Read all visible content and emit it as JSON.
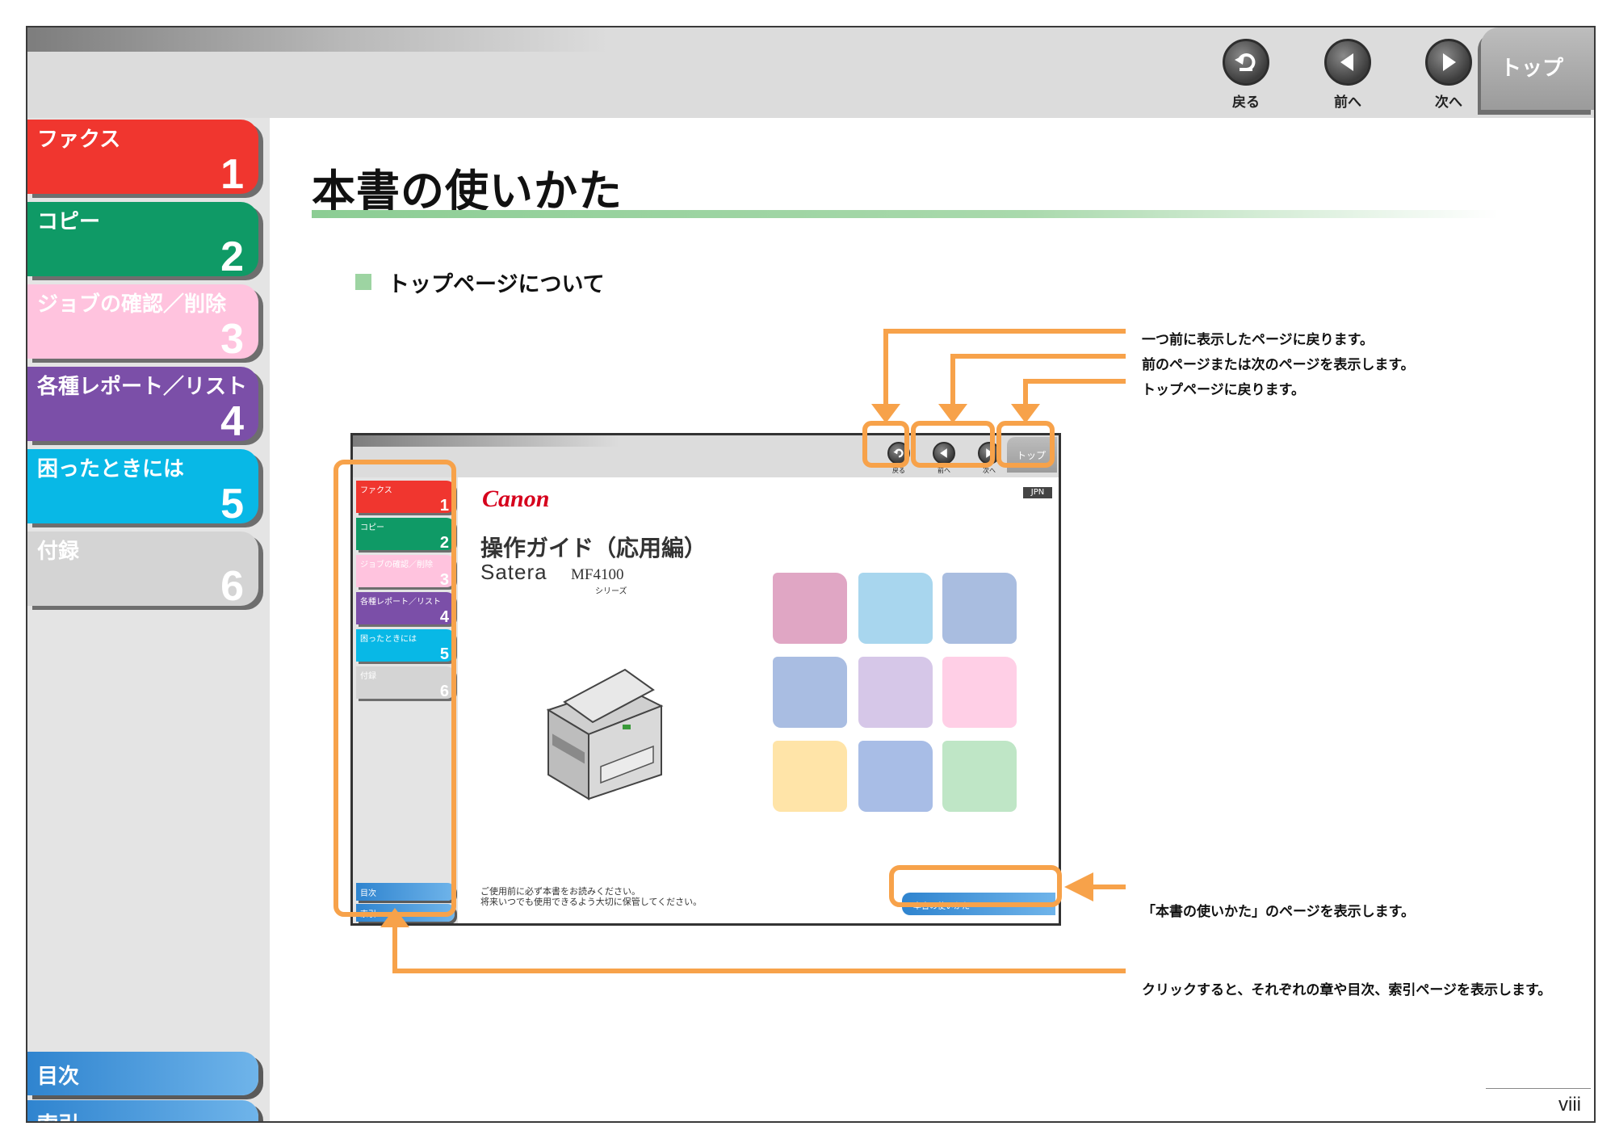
{
  "header": {
    "nav": [
      {
        "label": "戻る",
        "icon": "back-arrow-icon"
      },
      {
        "label": "前へ",
        "icon": "triangle-left-icon"
      },
      {
        "label": "次へ",
        "icon": "triangle-right-icon"
      }
    ],
    "top_tab": "トップ"
  },
  "sidebar": {
    "chapters": [
      {
        "label": "ファクス",
        "num": "1",
        "color": "#f0362f"
      },
      {
        "label": "コピー",
        "num": "2",
        "color": "#0f9a66"
      },
      {
        "label": "ジョブの確認／削除",
        "num": "3",
        "color": "#ffc3de"
      },
      {
        "label": "各種レポート／リスト",
        "num": "4",
        "color": "#7b4fa8"
      },
      {
        "label": "困ったときには",
        "num": "5",
        "color": "#08b8e6"
      },
      {
        "label": "付録",
        "num": "6",
        "color": "#d4d4d4"
      }
    ],
    "contents": "目次",
    "index": "索引"
  },
  "main": {
    "title": "本書の使いかた",
    "section": "トップページについて",
    "callouts": {
      "back": "一つ前に表示したページに戻ります。",
      "prevnext": "前のページまたは次のページを表示します。",
      "top": "トップページに戻ります。",
      "howto": "「本書の使いかた」のページを表示します。",
      "chapters": "クリックすると、それぞれの章や目次、索引ページを表示します。"
    },
    "page_number": "viii"
  },
  "mini": {
    "nav": [
      "戻る",
      "前へ",
      "次へ"
    ],
    "top_tab": "トップ",
    "logo": "Canon",
    "lang": "JPN",
    "guide_title": "操作ガイド（応用編）",
    "brand": "Satera",
    "model": "MF4100",
    "series": "シリーズ",
    "chapters": [
      {
        "label": "ファクス",
        "num": "1"
      },
      {
        "label": "コピー",
        "num": "2"
      },
      {
        "label": "ジョブの確認／削除",
        "num": "3"
      },
      {
        "label": "各種レポート／リスト",
        "num": "4"
      },
      {
        "label": "困ったときには",
        "num": "5"
      },
      {
        "label": "付録",
        "num": "6"
      }
    ],
    "contents": "目次",
    "index": "索引",
    "notice_line1": "ご使用前に必ず本書をお読みください。",
    "notice_line2": "将来いつでも使用できるよう大切に保管してください。",
    "howto_button": "本書の使いかた",
    "tile_colors": [
      "#e0a6c4",
      "#a8d6ee",
      "#a9bde0",
      "#a9bde2",
      "#d6c7e8",
      "#ffcfe6",
      "#ffe4a8",
      "#a8bde6",
      "#bfe6c6"
    ]
  }
}
